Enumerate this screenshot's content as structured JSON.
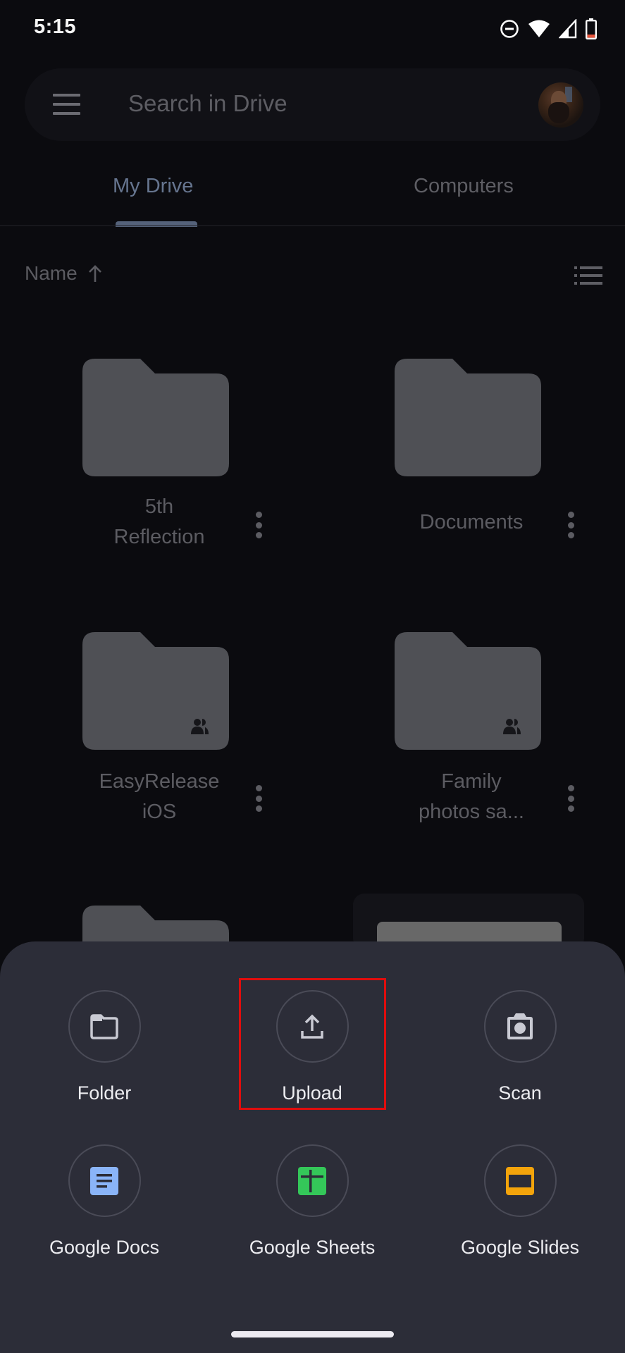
{
  "status_bar": {
    "time": "5:15",
    "icons": [
      "do-not-disturb-icon",
      "wifi-icon",
      "cell-signal-icon",
      "battery-low-icon"
    ],
    "battery_color": "#e8553b"
  },
  "search": {
    "menu_icon": "hamburger-menu-icon",
    "placeholder": "Search in Drive",
    "avatar": "account-avatar"
  },
  "tabs": [
    {
      "label": "My Drive",
      "selected": true
    },
    {
      "label": "Computers",
      "selected": false
    }
  ],
  "sort": {
    "label": "Name",
    "direction_icon": "arrow-up-icon",
    "view_toggle_icon": "list-view-icon"
  },
  "folders": [
    {
      "name_line1": "5th",
      "name_line2": "Reflection",
      "shared": false
    },
    {
      "name_line1": "Documents",
      "name_line2": "",
      "shared": false
    },
    {
      "name_line1": "EasyRelease",
      "name_line2": "iOS",
      "shared": true
    },
    {
      "name_line1": "Family",
      "name_line2": "photos sa...",
      "shared": true
    }
  ],
  "create_sheet": {
    "actions": [
      {
        "label": "Folder",
        "icon": "folder-icon"
      },
      {
        "label": "Upload",
        "icon": "upload-icon",
        "highlighted": true
      },
      {
        "label": "Scan",
        "icon": "camera-icon"
      },
      {
        "label": "Google Docs",
        "icon": "google-docs-icon",
        "color": "#8ab4f8"
      },
      {
        "label": "Google Sheets",
        "icon": "google-sheets-icon",
        "color": "#34c759"
      },
      {
        "label": "Google Slides",
        "icon": "google-slides-icon",
        "color": "#f4a40b"
      }
    ],
    "highlight_color": "#e00d0d"
  },
  "colors": {
    "background": "#0b0b0f",
    "sheet": "#2c2d38",
    "folder": "#4f5055",
    "tab_selected": "#66758f"
  }
}
